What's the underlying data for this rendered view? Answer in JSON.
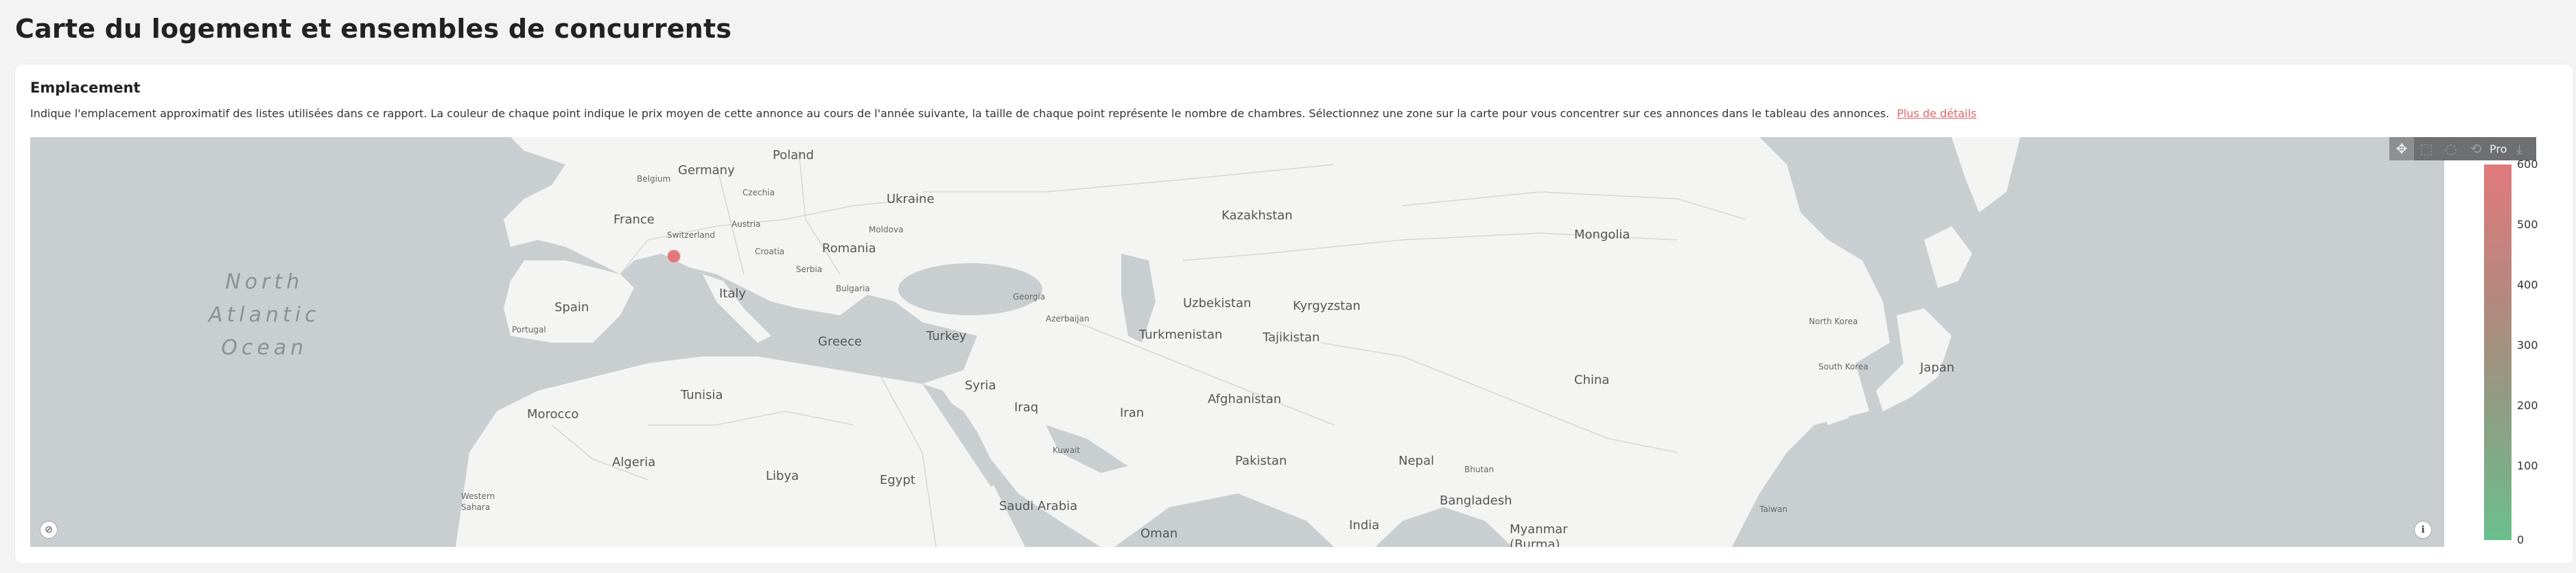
{
  "page": {
    "title": "Carte du logement et ensembles de concurrents"
  },
  "card": {
    "title": "Emplacement",
    "description": "Indique l'emplacement approximatif des listes utilisées dans ce rapport. La couleur de chaque point indique le prix moyen de cette annonce au cours de l'année suivante, la taille de chaque point représente le nombre de chambres. Sélectionnez une zone sur la carte pour vous concentrer sur ces annonces dans le tableau des annonces.",
    "details_link": "Plus de détails"
  },
  "map": {
    "labels": {
      "north_atlantic_ocean": "North\nAtlantic\nOcean",
      "poland": "Poland",
      "germany": "Germany",
      "belgium": "Belgium",
      "czechia": "Czechia",
      "france": "France",
      "switzerland": "Switzerland",
      "austria": "Austria",
      "ukraine": "Ukraine",
      "moldova": "Moldova",
      "croatia": "Croatia",
      "romania": "Romania",
      "serbia": "Serbia",
      "italy": "Italy",
      "bulgaria": "Bulgaria",
      "spain": "Spain",
      "portugal": "Portugal",
      "greece": "Greece",
      "turkey": "Turkey",
      "georgia": "Georgia",
      "azerbaijan": "Azerbaijan",
      "kazakhstan": "Kazakhstan",
      "uzbekistan": "Uzbekistan",
      "kyrgyzstan": "Kyrgyzstan",
      "turkmenistan": "Turkmenistan",
      "tajikistan": "Tajikistan",
      "mongolia": "Mongolia",
      "china": "China",
      "north_korea": "North Korea",
      "south_korea": "South Korea",
      "japan": "Japan",
      "tunisia": "Tunisia",
      "morocco": "Morocco",
      "algeria": "Algeria",
      "libya": "Libya",
      "egypt": "Egypt",
      "syria": "Syria",
      "iraq": "Iraq",
      "iran": "Iran",
      "kuwait": "Kuwait",
      "afghanistan": "Afghanistan",
      "pakistan": "Pakistan",
      "nepal": "Nepal",
      "bhutan": "Bhutan",
      "bangladesh": "Bangladesh",
      "india": "India",
      "myanmar": "Myanmar\n(Burma)",
      "saudi_arabia": "Saudi Arabia",
      "oman": "Oman",
      "western_sahara": "Western\nSahara",
      "taiwan": "Taiwan"
    },
    "listing_points": [
      {
        "location": "France",
        "price": 600
      }
    ],
    "toolbar": {
      "overflow_label": "Pro",
      "tools": [
        "pan-icon",
        "box-select-icon",
        "lasso-icon",
        "reset-icon",
        "save-icon"
      ]
    }
  },
  "legend": {
    "colors": {
      "high": "#e0797c",
      "low": "#6bbf8c"
    },
    "min": 0,
    "max": 600,
    "ticks": [
      "600",
      "500",
      "400",
      "300",
      "200",
      "100",
      "0"
    ]
  }
}
